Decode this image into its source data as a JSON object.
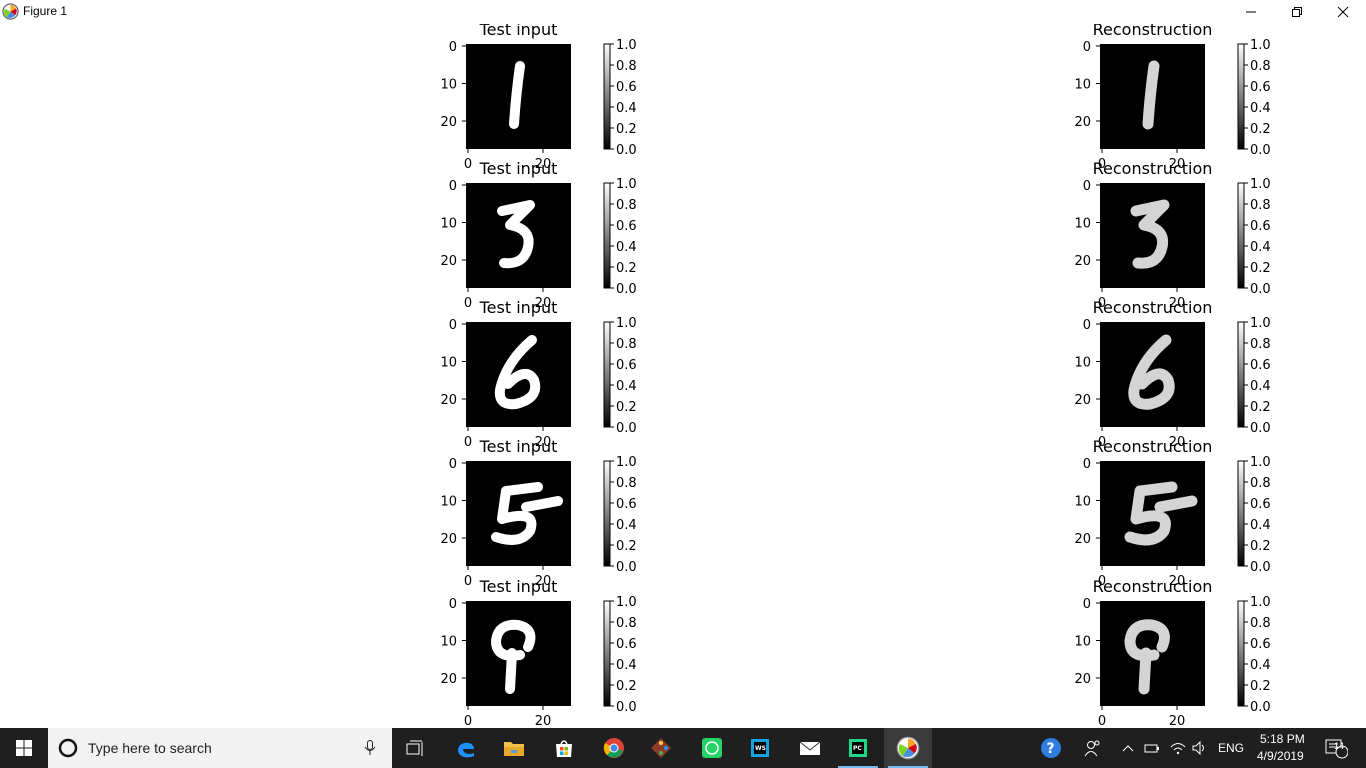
{
  "window": {
    "title": "Figure 1",
    "controls": {
      "minimize": "minimize",
      "maximize": "restore",
      "close": "close"
    }
  },
  "figure": {
    "rows": [
      {
        "digit": "1",
        "left_title": "Test input",
        "right_title": "Reconstruction"
      },
      {
        "digit": "3",
        "left_title": "Test input",
        "right_title": "Reconstruction"
      },
      {
        "digit": "6",
        "left_title": "Test input",
        "right_title": "Reconstruction"
      },
      {
        "digit": "5",
        "left_title": "Test input",
        "right_title": "Reconstruction"
      },
      {
        "digit": "9",
        "left_title": "Test input",
        "right_title": "Reconstruction"
      }
    ],
    "y_ticks": [
      "0",
      "10",
      "20"
    ],
    "x_ticks": [
      "0",
      "20"
    ],
    "colorbar_ticks": [
      "1.0",
      "0.8",
      "0.6",
      "0.4",
      "0.2",
      "0.0"
    ]
  },
  "taskbar": {
    "search_placeholder": "Type here to search",
    "language": "ENG",
    "time": "5:18 PM",
    "date": "4/9/2019",
    "notification_count": "14",
    "apps": [
      "task-view",
      "edge",
      "file-explorer",
      "store",
      "chrome",
      "git",
      "whatsapp",
      "webstorm",
      "mail",
      "pycharm",
      "matplotlib-figure"
    ]
  }
}
